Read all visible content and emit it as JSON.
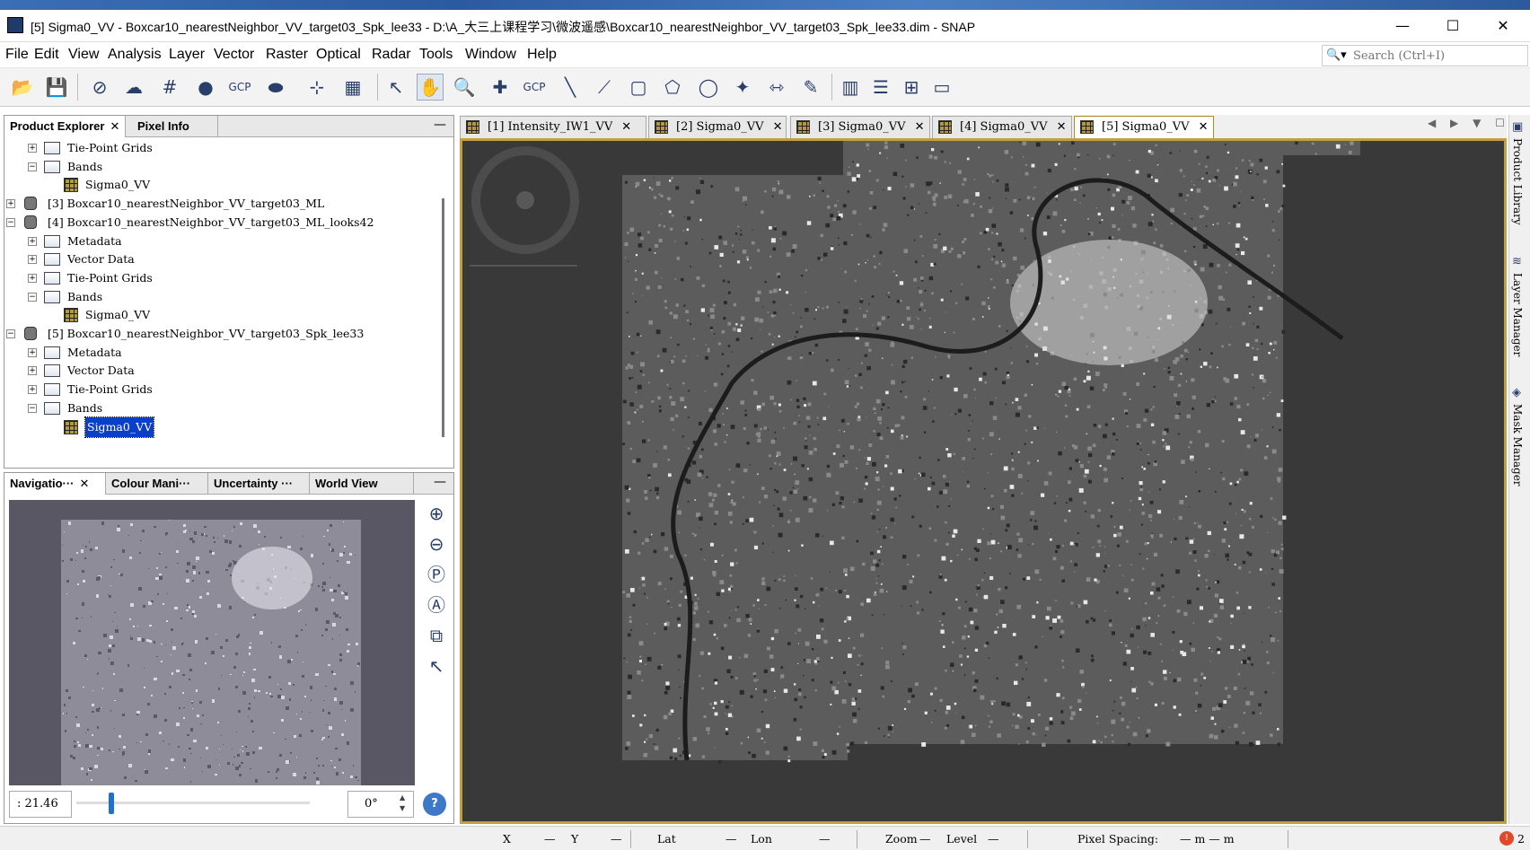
{
  "window": {
    "title": "[5] Sigma0_VV - Boxcar10_nearestNeighbor_VV_target03_Spk_lee33 - D:\\A_大三上课程学习\\微波遥感\\Boxcar10_nearestNeighbor_VV_target03_Spk_lee33.dim - SNAP",
    "minimize": "—",
    "maximize": "☐",
    "close": "✕"
  },
  "menu": [
    "File",
    "Edit",
    "View",
    "Analysis",
    "Layer",
    "Vector",
    "Raster",
    "Optical",
    "Radar",
    "Tools",
    "Window",
    "Help"
  ],
  "search": {
    "placeholder": "Search (Ctrl+I)",
    "icon": "search-icon"
  },
  "toolbar": {
    "icons": [
      "open-product-icon",
      "save-product-icon",
      "no-data-overlay-icon",
      "world-map-overlay-icon",
      "graticule-overlay-icon",
      "pin-overlay-icon",
      "gcp-overlay-icon",
      "shapes-overlay-icon",
      "pin-manager-icon",
      "gcp-manager-icon",
      "select-tool-icon",
      "pan-tool-icon",
      "zoom-tool-icon",
      "pin-placing-tool-icon",
      "gcp-placing-tool-icon",
      "line-drawing-tool-icon",
      "polyline-drawing-tool-icon",
      "rectangle-drawing-tool-icon",
      "polygon-drawing-tool-icon",
      "ellipse-drawing-tool-icon",
      "magic-wand-tool-icon",
      "range-finder-tool-icon",
      "tile-evenly-icon",
      "tile-horizontally-icon",
      "tile-vertically-icon",
      "tile-single-icon"
    ],
    "gcp_label": "GCP"
  },
  "product_explorer": {
    "tabs": [
      {
        "label": "Product Explorer",
        "close": "✕"
      },
      {
        "label": "Pixel Info"
      }
    ],
    "minimize": "—",
    "tree": [
      {
        "label": "Tie-Point Grids",
        "kind": "folder",
        "expander": "+"
      },
      {
        "label": "Bands",
        "kind": "folder",
        "expander": "−"
      },
      {
        "label": "Sigma0_VV",
        "kind": "band"
      },
      {
        "label": "[3]  Boxcar10_nearestNeighbor_VV_target03_ML",
        "kind": "product",
        "expander": "+"
      },
      {
        "label": "[4]  Boxcar10_nearestNeighbor_VV_target03_ML_looks42",
        "kind": "product",
        "expander": "−"
      },
      {
        "label": "Metadata",
        "kind": "folder",
        "expander": "+"
      },
      {
        "label": "Vector Data",
        "kind": "folder",
        "expander": "+"
      },
      {
        "label": "Tie-Point Grids",
        "kind": "folder",
        "expander": "+"
      },
      {
        "label": "Bands",
        "kind": "folder",
        "expander": "−"
      },
      {
        "label": "Sigma0_VV",
        "kind": "band"
      },
      {
        "label": "[5]  Boxcar10_nearestNeighbor_VV_target03_Spk_lee33",
        "kind": "product",
        "expander": "−"
      },
      {
        "label": "Metadata",
        "kind": "folder",
        "expander": "+"
      },
      {
        "label": "Vector Data",
        "kind": "folder",
        "expander": "+"
      },
      {
        "label": "Tie-Point Grids",
        "kind": "folder",
        "expander": "+"
      },
      {
        "label": "Bands",
        "kind": "folder",
        "expander": "−"
      },
      {
        "label": "Sigma0_VV",
        "kind": "band",
        "selected": true
      }
    ]
  },
  "navigation_panel": {
    "tabs": [
      {
        "label": "Navigatio···",
        "close": "✕"
      },
      {
        "label": "Colour Mani···"
      },
      {
        "label": "Uncertainty ···"
      },
      {
        "label": "World View"
      }
    ],
    "minimize": "—",
    "zoom_value": ": 21.46",
    "zoom_level": 0.14,
    "rotation": "0°",
    "help": "?",
    "spinner_up": "▲",
    "spinner_down": "▼",
    "tool_icons": [
      "zoom-in-icon",
      "zoom-out-icon",
      "zoom-pixel-icon",
      "zoom-all-icon",
      "sync-views-icon",
      "sync-cursor-icon"
    ]
  },
  "image_view": {
    "tabs": [
      {
        "label": "[1]  Intensity_IW1_VV",
        "close": "✕"
      },
      {
        "label": "[2]  Sigma0_VV",
        "close": "✕"
      },
      {
        "label": "[3]  Sigma0_VV",
        "close": "✕"
      },
      {
        "label": "[4]  Sigma0_VV",
        "close": "✕"
      },
      {
        "label": "[5]  Sigma0_VV",
        "close": "✕",
        "active": true
      }
    ],
    "controls": "◀ ▶ ▼ ☐"
  },
  "right_sidebar": {
    "items": [
      {
        "label": "Product Library",
        "icon": "product-library-icon"
      },
      {
        "label": "Layer Manager",
        "icon": "layer-manager-icon"
      },
      {
        "label": "Mask Manager",
        "icon": "mask-manager-icon"
      }
    ]
  },
  "status_bar": {
    "x_label": "X",
    "x_value": "—",
    "y_label": "Y",
    "y_value": "—",
    "lat_label": "Lat",
    "lat_value": "—",
    "lon_label": "Lon",
    "lon_value": "—",
    "zoom_label": "Zoom",
    "zoom_value": "—",
    "level_label": "Level",
    "level_value": "—",
    "pixel_spacing_label": "Pixel Spacing:",
    "pixel_spacing_value": "— m — m",
    "error_count": "2"
  },
  "colors": {
    "accent": "#0b3fc7",
    "active_tab_border": "#c0a040",
    "view_bg": "#393939",
    "nav_bg": "#5a5765"
  }
}
